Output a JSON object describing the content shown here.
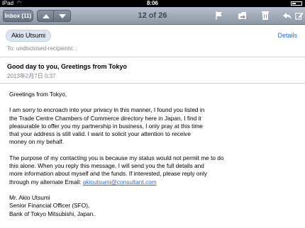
{
  "statusbar": {
    "carrier": "iPad",
    "time": "8:06",
    "wifi_icon": "wifi-icon",
    "battery_icon": "battery-icon"
  },
  "toolbar": {
    "inbox_label": "Inbox (11)",
    "counter": "12 of 26",
    "icons": [
      "flag-icon",
      "folder-icon",
      "trash-icon",
      "reply-icon",
      "compose-icon"
    ]
  },
  "header": {
    "from": "Akio Utsumi",
    "details_label": "Details",
    "to": "To: undisclosed-recipients: ;",
    "subject": "Good day to you, Greetings from Tokyo",
    "date": "2013年2月7日 0:37"
  },
  "message": {
    "greeting": "Greetings from Tokyo,",
    "para1": "I am sorry to encroach into your privacy in this manner, I found you listed in\nthe Trade Centre Chambers of Commerce directory here in Japan, I find it\npleasurable to offer you my partnership in business, I only pray at this time\nthat your address is still valid. I want to solicit your attention to receive\nmoney on my behalf.",
    "para2": "The purpose of my contacting you is because my status would not permit me to do\nthis alone. When you reply this message, I will send you the full details and\nmore information about myself and the funds. If interested, please reply only\nthrough my alternate Email: ",
    "email": "akioutsumi@consultant.com",
    "signature": "Mr. Akio Utsumi\nSenior Financial Officer (SFO),\nBank of Tokyo Mitsubishi, Japan."
  }
}
